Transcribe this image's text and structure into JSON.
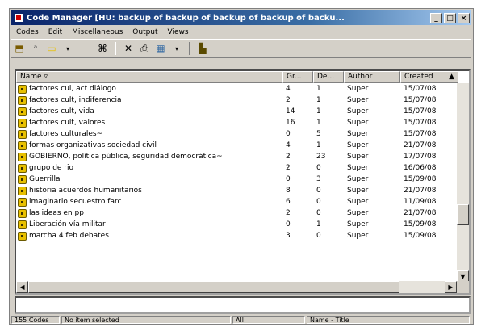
{
  "window": {
    "title": "Code Manager [HU: backup of backup of backup of backup of backu...",
    "controls": [
      "_",
      "□",
      "×"
    ]
  },
  "menu": [
    "Codes",
    "Edit",
    "Miscellaneous",
    "Output",
    "Views"
  ],
  "toolbar": {
    "icons": [
      "new-code-icon",
      "rename-code-icon",
      "color-icon",
      "dropdown-arrow-icon",
      "merge-codes-icon",
      "delete-icon",
      "print-icon",
      "grid-view-icon",
      "dropdown-arrow-icon",
      "network-view-icon"
    ],
    "glyphs": [
      "⬒",
      "ᵃ",
      "▭",
      "▾",
      "⌘",
      "✕",
      "⎙",
      "▦",
      "▾",
      "▙"
    ]
  },
  "columns": [
    {
      "label": "Name",
      "sort": "▿"
    },
    {
      "label": "Gr..."
    },
    {
      "label": "De..."
    },
    {
      "label": "Author"
    },
    {
      "label": "Created",
      "sort": "▲"
    }
  ],
  "rows": [
    {
      "name": "factores cul, act diálogo",
      "gr": "4",
      "de": "1",
      "author": "Super",
      "created": "15/07/08"
    },
    {
      "name": "factores cult,  indiferencia",
      "gr": "2",
      "de": "1",
      "author": "Super",
      "created": "15/07/08"
    },
    {
      "name": "factores cult,  vida",
      "gr": "14",
      "de": "1",
      "author": "Super",
      "created": "15/07/08"
    },
    {
      "name": "factores cult, valores",
      "gr": "16",
      "de": "1",
      "author": "Super",
      "created": "15/07/08"
    },
    {
      "name": "factores culturales~",
      "gr": "0",
      "de": "5",
      "author": "Super",
      "created": "15/07/08"
    },
    {
      "name": "formas organizativas sociedad civil",
      "gr": "4",
      "de": "1",
      "author": "Super",
      "created": "21/07/08"
    },
    {
      "name": "GOBIERNO, política pública, seguridad democrática~",
      "gr": "2",
      "de": "23",
      "author": "Super",
      "created": "17/07/08"
    },
    {
      "name": "grupo de rio",
      "gr": "2",
      "de": "0",
      "author": "Super",
      "created": "16/06/08"
    },
    {
      "name": "Guerrilla",
      "gr": "0",
      "de": "3",
      "author": "Super",
      "created": "15/09/08"
    },
    {
      "name": "historia acuerdos humanitarios",
      "gr": "8",
      "de": "0",
      "author": "Super",
      "created": "21/07/08"
    },
    {
      "name": "imaginario secuestro farc",
      "gr": "6",
      "de": "0",
      "author": "Super",
      "created": "11/09/08"
    },
    {
      "name": "las ideas en pp",
      "gr": "2",
      "de": "0",
      "author": "Super",
      "created": "21/07/08"
    },
    {
      "name": "Liberación vía militar",
      "gr": "0",
      "de": "1",
      "author": "Super",
      "created": "15/09/08"
    },
    {
      "name": "marcha 4 feb debates",
      "gr": "3",
      "de": "0",
      "author": "Super",
      "created": "15/09/08"
    }
  ],
  "status": {
    "count": "155 Codes",
    "selection": "No item selected",
    "filter": "All",
    "sort": "Name - Title"
  }
}
